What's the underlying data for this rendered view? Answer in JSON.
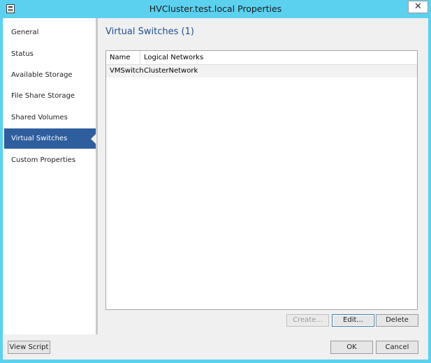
{
  "window": {
    "title": "HVCluster.test.local Properties"
  },
  "nav": {
    "items": [
      {
        "label": "General"
      },
      {
        "label": "Status"
      },
      {
        "label": "Available Storage"
      },
      {
        "label": "File Share Storage"
      },
      {
        "label": "Shared Volumes"
      },
      {
        "label": "Virtual Switches",
        "selected": true
      },
      {
        "label": "Custom Properties"
      }
    ]
  },
  "main": {
    "heading": "Virtual Switches (1)",
    "table": {
      "columns": [
        "Name",
        "Logical Networks"
      ],
      "rows": [
        [
          "VMSwitch",
          "ClusterNetwork"
        ]
      ]
    },
    "buttons": {
      "create": "Create...",
      "edit": "Edit...",
      "delete": "Delete"
    }
  },
  "footer": {
    "view_script": "View Script",
    "ok": "OK",
    "cancel": "Cancel"
  },
  "icons": {
    "app": "properties-window-icon",
    "close": "close-icon"
  },
  "colors": {
    "titlebar": "#5bd1ef",
    "nav_selected": "#2e5e9e",
    "heading": "#1f4f8f"
  }
}
